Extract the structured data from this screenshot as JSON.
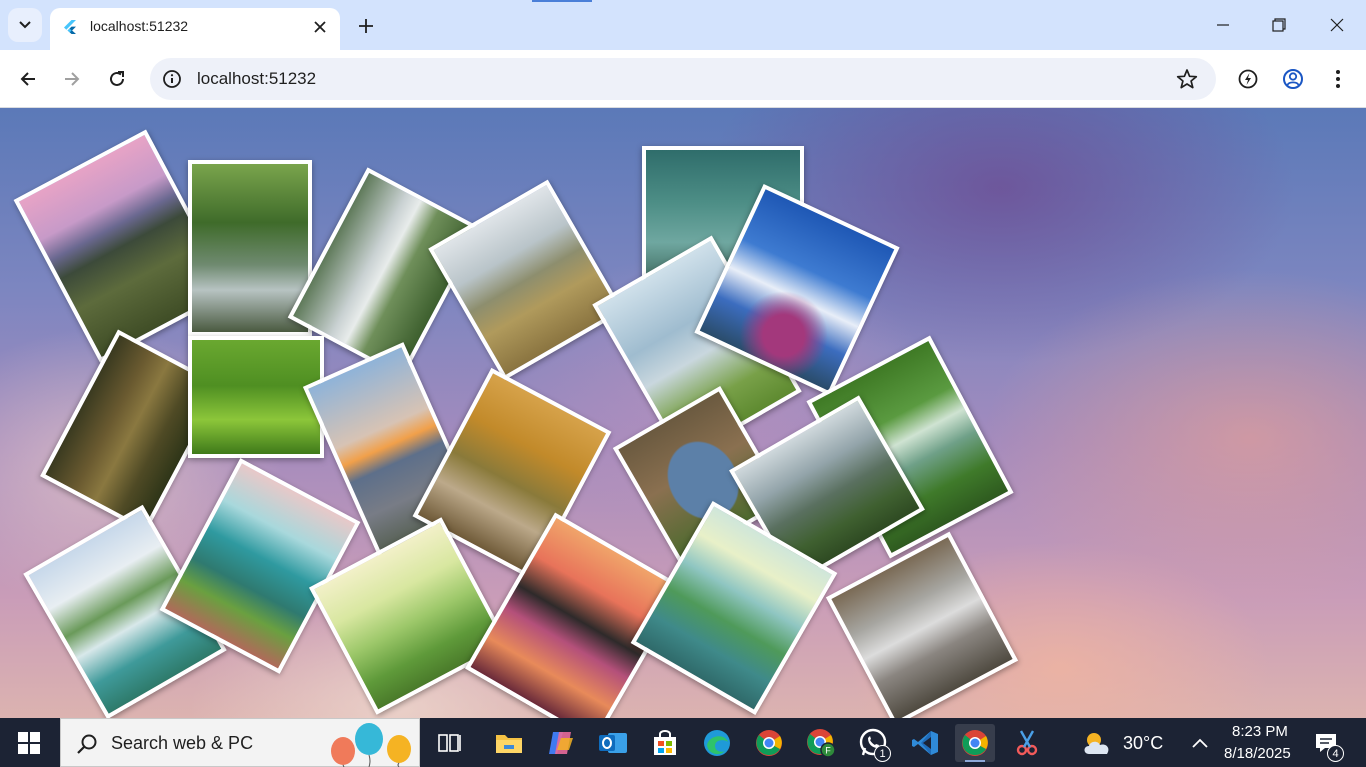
{
  "browser": {
    "tab_title": "localhost:51232",
    "url": "localhost:51232"
  },
  "page": {
    "photo_count": 21
  },
  "taskbar": {
    "search_placeholder": "Search web & PC",
    "weather_temp": "30°C",
    "time": "8:23 PM",
    "date": "8/18/2025",
    "whatsapp_badge": "1",
    "notification_badge": "4"
  },
  "colors": {
    "tabstrip": "#d3e3fd",
    "toolbar": "#ffffff",
    "taskbar": "#1c2334",
    "photo_border": "#ffffff"
  }
}
